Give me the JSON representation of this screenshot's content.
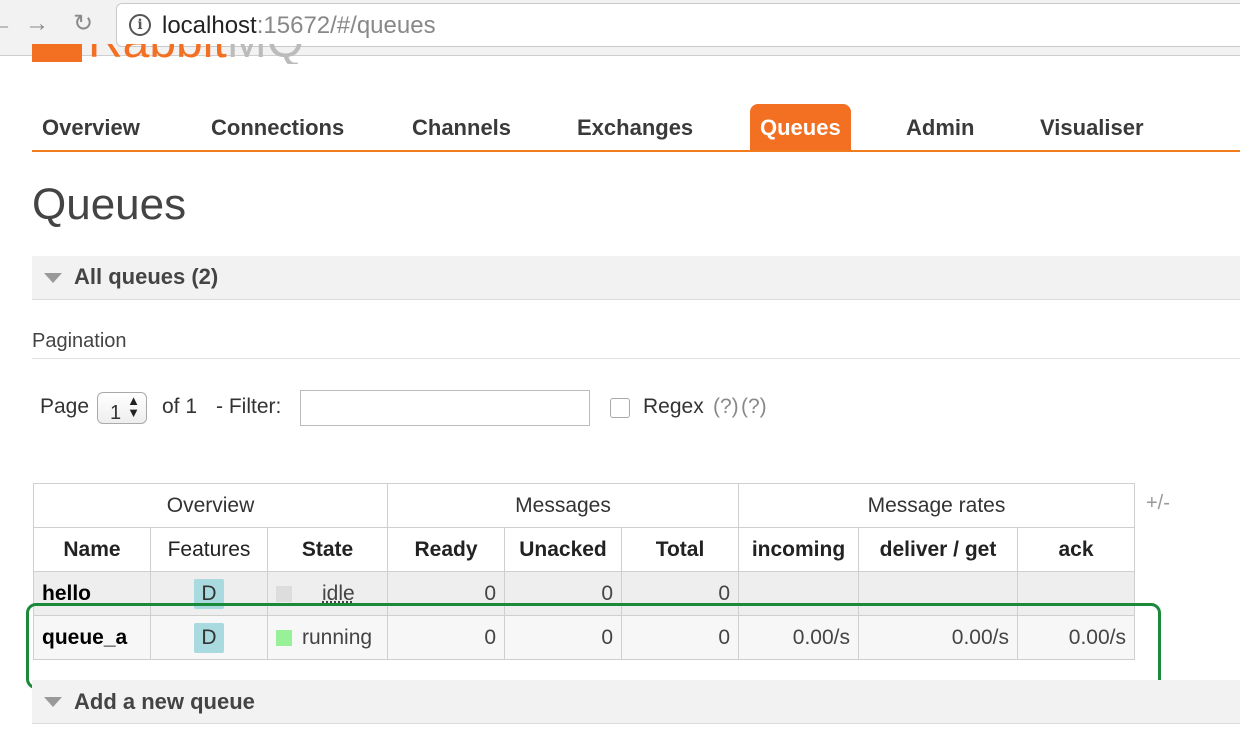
{
  "browser": {
    "url_host": "localhost",
    "url_rest": ":15672/#/queues",
    "back_glyph": "←",
    "forward_glyph": "→",
    "reload_glyph": "↻"
  },
  "logo": {
    "text_main": "Rabbit",
    "text_mq": "MQ"
  },
  "tabs": [
    {
      "label": "Overview",
      "active": false
    },
    {
      "label": "Connections",
      "active": false
    },
    {
      "label": "Channels",
      "active": false
    },
    {
      "label": "Exchanges",
      "active": false
    },
    {
      "label": "Queues",
      "active": true
    },
    {
      "label": "Admin",
      "active": false
    },
    {
      "label": "Visualiser",
      "active": false
    }
  ],
  "page_title": "Queues",
  "all_queues_header": "All queues (2)",
  "pagination": {
    "title": "Pagination",
    "page_label": "Page",
    "page_value": "1",
    "of_label": "of 1",
    "filter_label": "- Filter:",
    "filter_value": "",
    "regex_label": "Regex",
    "help_1": "(?)",
    "help_2": "(?)"
  },
  "table": {
    "group_headers": [
      "Overview",
      "Messages",
      "Message rates"
    ],
    "columns": [
      "Name",
      "Features",
      "State",
      "Ready",
      "Unacked",
      "Total",
      "incoming",
      "deliver / get",
      "ack"
    ],
    "plus_minus": "+/-",
    "rows": [
      {
        "name": "hello",
        "feature": "D",
        "state": "idle",
        "state_color": "#dddddd",
        "ready": "0",
        "unacked": "0",
        "total": "0",
        "incoming": "",
        "deliver_get": "",
        "ack": ""
      },
      {
        "name": "queue_a",
        "feature": "D",
        "state": "running",
        "state_color": "#98f098",
        "ready": "0",
        "unacked": "0",
        "total": "0",
        "incoming": "0.00/s",
        "deliver_get": "0.00/s",
        "ack": "0.00/s"
      }
    ]
  },
  "add_queue_header": "Add a new queue",
  "colors": {
    "accent": "#f36f21",
    "highlight": "#1a8a3a"
  }
}
